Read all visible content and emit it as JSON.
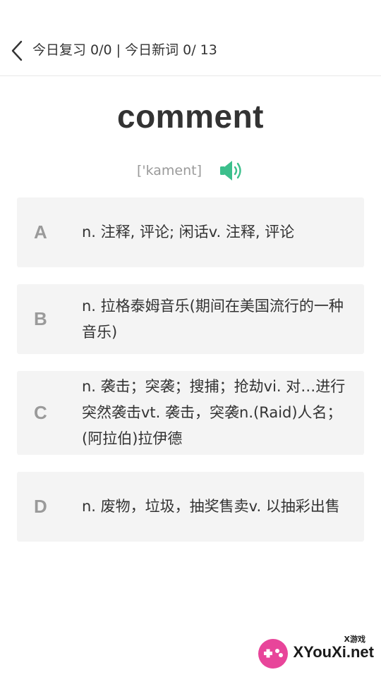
{
  "header": {
    "title": "今日复习 0/0 | 今日新词 0/ 13",
    "back_icon": "chevron-left-icon"
  },
  "word": {
    "text": "comment",
    "phonetic": "['kament]",
    "speaker_icon": "speaker-icon",
    "accent_color": "#3cbf8c"
  },
  "options": [
    {
      "letter": "A",
      "text": "n. 注释, 评论; 闲话v. 注释, 评论"
    },
    {
      "letter": "B",
      "text": "n. 拉格泰姆音乐(期间在美国流行的一种音乐)"
    },
    {
      "letter": "C",
      "text": "n. 袭击；突袭；搜捕；抢劫vi. 对…进行突然袭击vt. 袭击，突袭n.(Raid)人名；(阿拉伯)拉伊德"
    },
    {
      "letter": "D",
      "text": "n. 废物，垃圾，抽奖售卖v. 以抽彩出售"
    }
  ],
  "watermark": {
    "small": "X游戏",
    "big": "XYouXi.net"
  }
}
